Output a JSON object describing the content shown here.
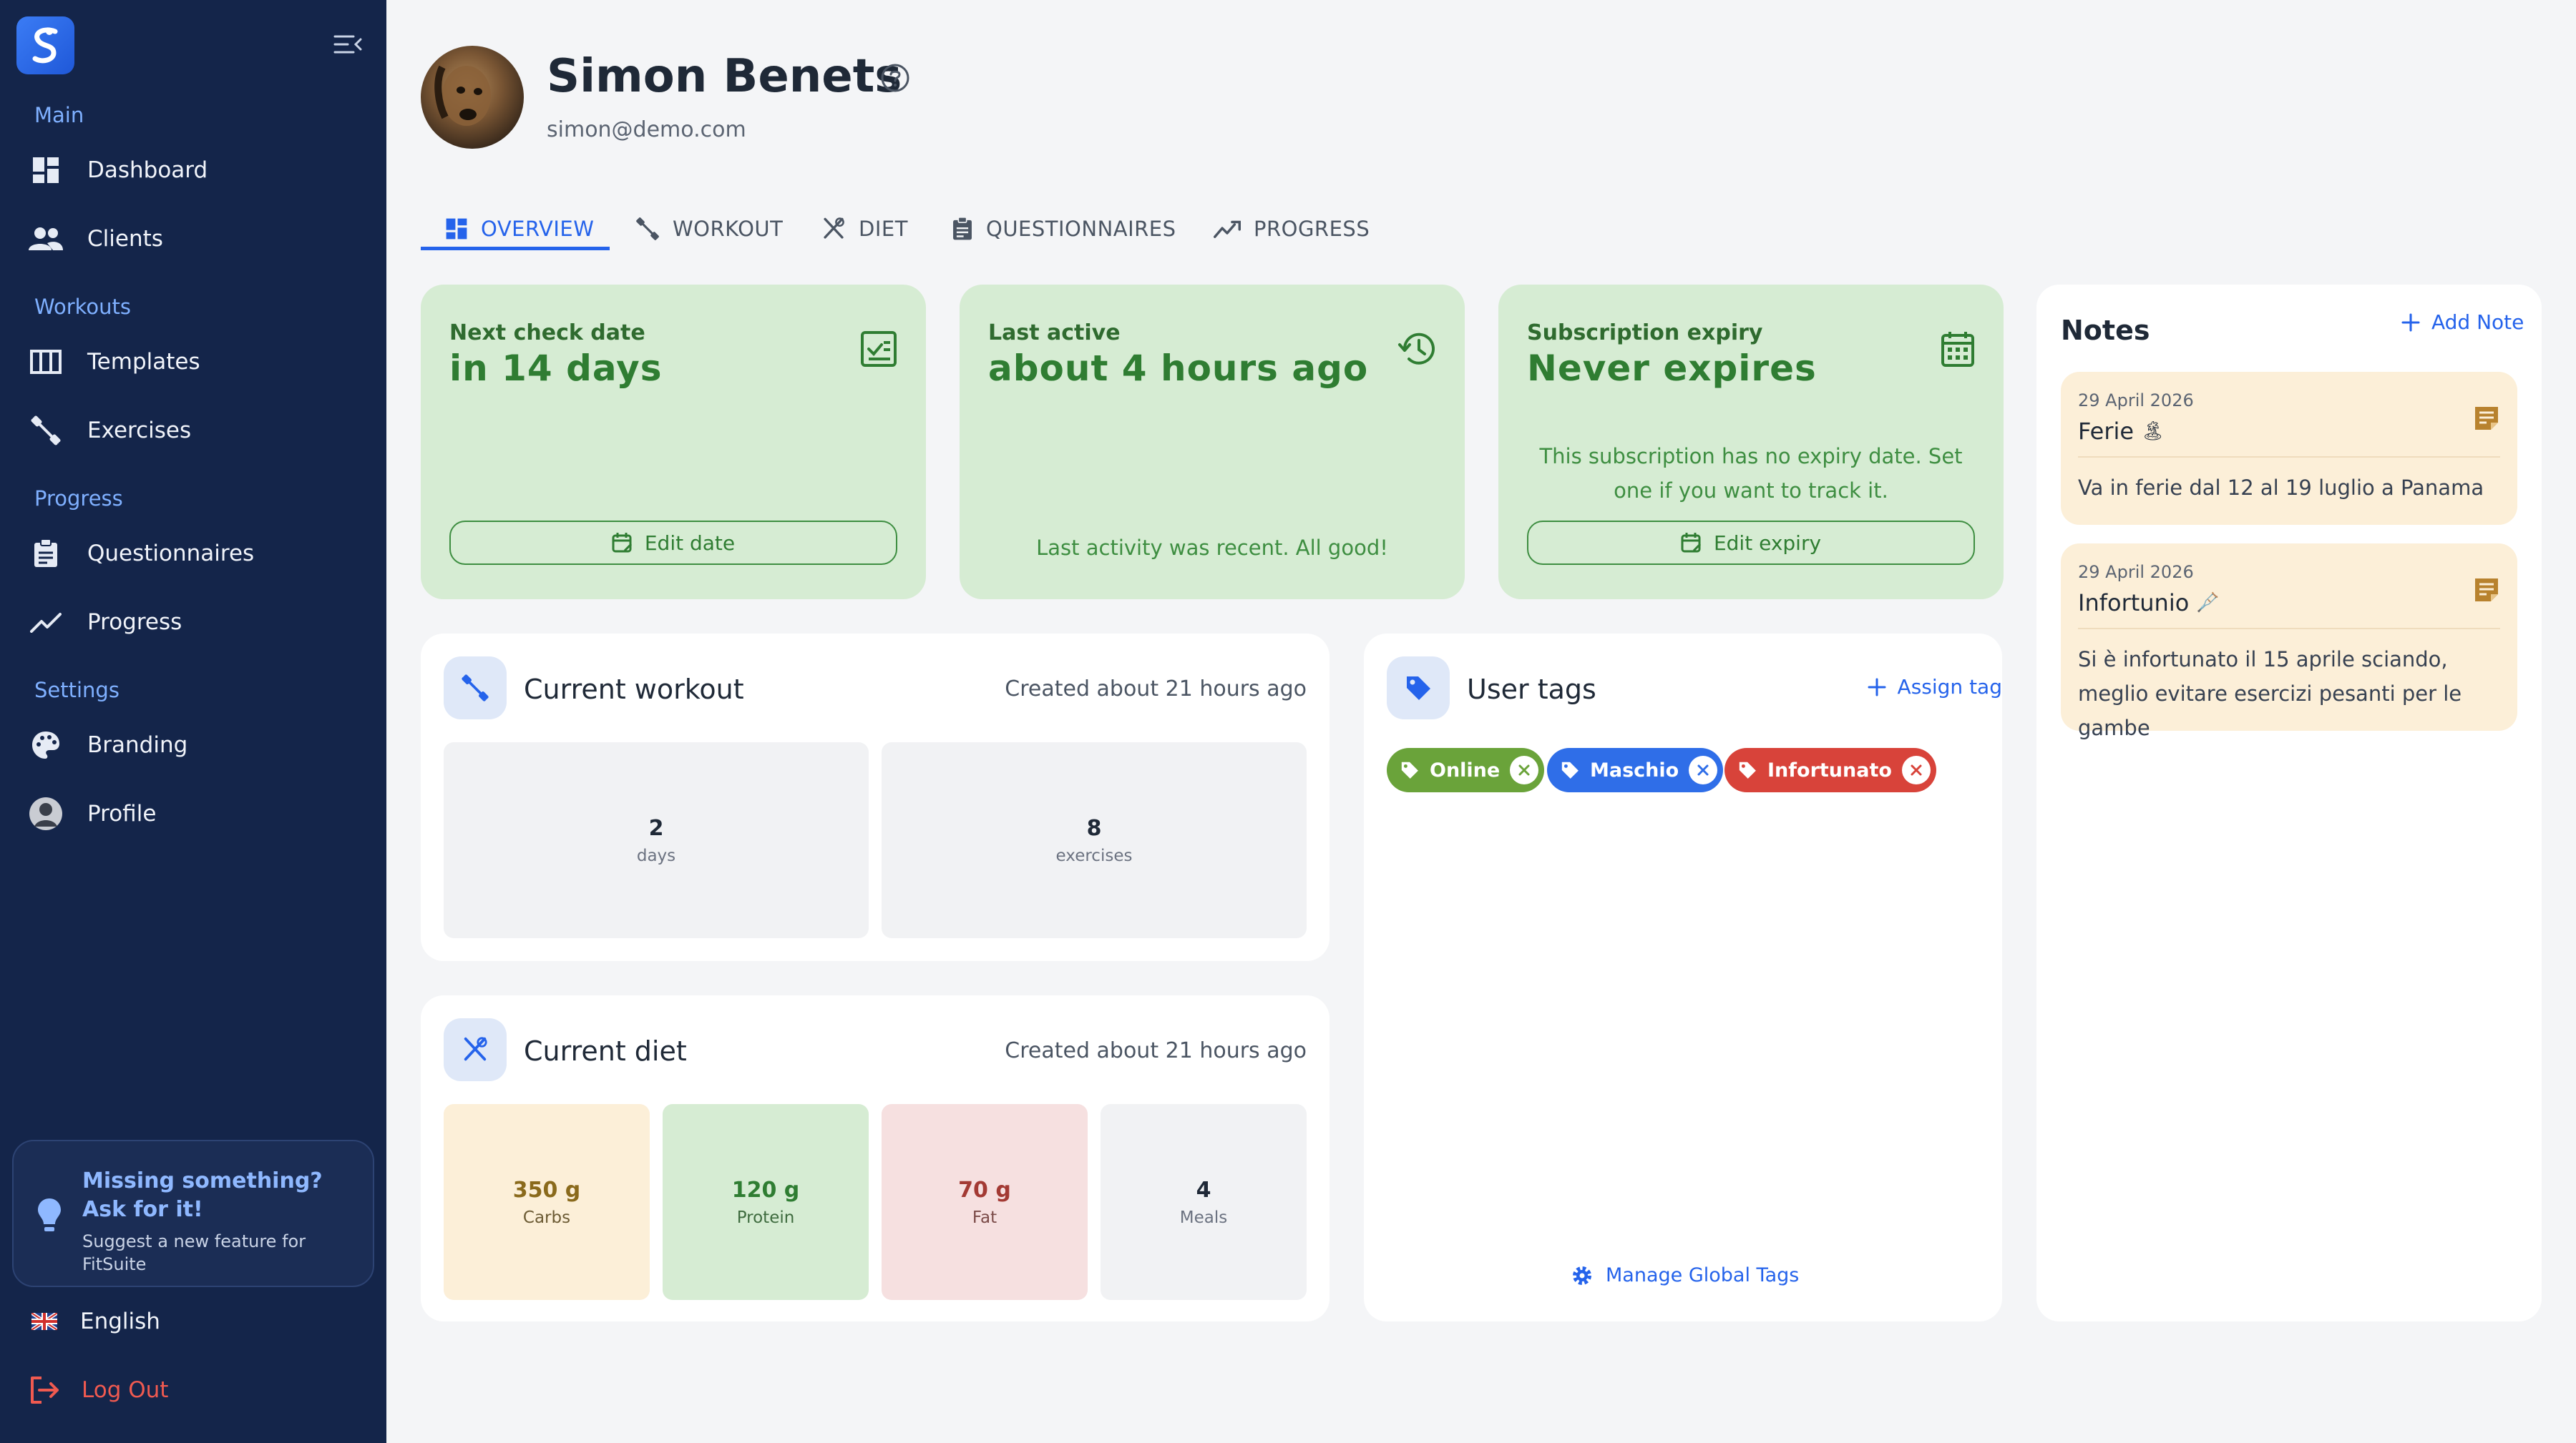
{
  "sidebar": {
    "sections": {
      "main": "Main",
      "workouts": "Workouts",
      "progress": "Progress",
      "settings": "Settings"
    },
    "items": {
      "dashboard": "Dashboard",
      "clients": "Clients",
      "templates": "Templates",
      "exercises": "Exercises",
      "questionnaires": "Questionnaires",
      "progress": "Progress",
      "branding": "Branding",
      "profile": "Profile"
    },
    "feature": {
      "title": "Missing something? Ask for it!",
      "subtitle": "Suggest a new feature for FitSuite"
    },
    "language": "English",
    "logout": "Log Out"
  },
  "client": {
    "name": "Simon Benets",
    "email": "simon@demo.com"
  },
  "tabs": {
    "overview": "OVERVIEW",
    "workout": "WORKOUT",
    "diet": "DIET",
    "questionnaires": "QUESTIONNAIRES",
    "progress": "PROGRESS"
  },
  "status": {
    "checkin": {
      "label": "Next check date",
      "value": "in 14 days",
      "button": "Edit date"
    },
    "active": {
      "label": "Last active",
      "value": "about 4 hours ago",
      "message": "Last activity was recent. All good!"
    },
    "subscription": {
      "label": "Subscription expiry",
      "value": "Never expires",
      "message": "This subscription has no expiry date. Set one if you want to track it.",
      "button": "Edit expiry"
    }
  },
  "workout": {
    "title": "Current workout",
    "created": "Created about 21 hours ago",
    "days_value": "2",
    "days_label": "days",
    "exercises_value": "8",
    "exercises_label": "exercises"
  },
  "diet": {
    "title": "Current diet",
    "created": "Created about 21 hours ago",
    "carbs_value": "350 g",
    "carbs_label": "Carbs",
    "protein_value": "120 g",
    "protein_label": "Protein",
    "fat_value": "70 g",
    "fat_label": "Fat",
    "meals_value": "4",
    "meals_label": "Meals"
  },
  "tags": {
    "title": "User tags",
    "assign": "Assign tag",
    "manage": "Manage Global Tags",
    "items": [
      {
        "label": "Online",
        "color": "#6aa33a"
      },
      {
        "label": "Maschio",
        "color": "#2f6ee8"
      },
      {
        "label": "Infortunato",
        "color": "#d8433a"
      }
    ]
  },
  "notes": {
    "title": "Notes",
    "add": "Add Note",
    "items": [
      {
        "date": "29 April 2026",
        "title": "Ferie",
        "emoji": "🏝",
        "body": "Va in ferie dal 12 al 19 luglio a Panama"
      },
      {
        "date": "29 April 2026",
        "title": "Infortunio",
        "emoji": "🩼",
        "body": "Si è infortunato il 15 aprile sciando, meglio evitare esercizi pesanti per le gambe"
      }
    ]
  },
  "colors": {
    "sidebar_bg": "#14254a",
    "accent": "#2563eb",
    "status_card_bg": "#d6ecd3",
    "status_text": "#2f7d32",
    "note_bg": "#fcefd8"
  }
}
